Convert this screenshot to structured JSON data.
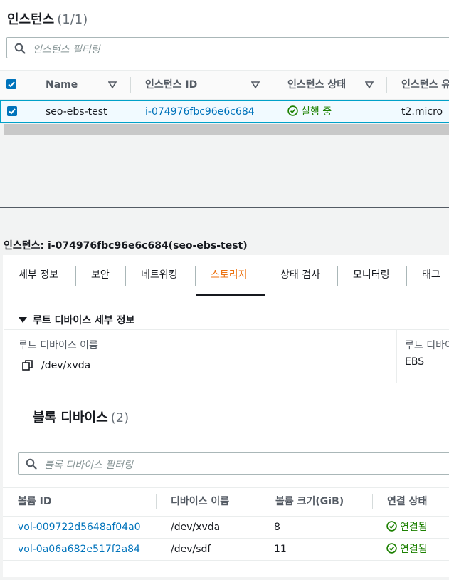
{
  "instances": {
    "title": "인스턴스",
    "count": "(1/1)",
    "filter_placeholder": "인스턴스 필터링",
    "columns": [
      "Name",
      "인스턴스 ID",
      "인스턴스 상태",
      "인스턴스 유"
    ],
    "rows": [
      {
        "name": "seo-ebs-test",
        "instance_id": "i-074976fbc96e6c684",
        "state": "실행 중",
        "type": "t2.micro"
      }
    ]
  },
  "detail": {
    "title_prefix": "인스턴스:",
    "title_value": "i-074976fbc96e6c684(seo-ebs-test)",
    "tabs": [
      "세부 정보",
      "보안",
      "네트워킹",
      "스토리지",
      "상태 검사",
      "모니터링",
      "태그"
    ],
    "active_tab": "스토리지",
    "root_section": {
      "heading": "루트 디바이스 세부 정보",
      "device_name_label": "루트 디바이스 이름",
      "device_name_value": "/dev/xvda",
      "device_type_label": "루트 디바이",
      "device_type_value": "EBS"
    },
    "block_devices": {
      "title": "블록 디바이스",
      "count": "(2)",
      "filter_placeholder": "블록 디바이스 필터링",
      "columns": [
        "볼륨 ID",
        "디바이스 이름",
        "볼륨 크기(GiB)",
        "연결 상태"
      ],
      "rows": [
        {
          "volume_id": "vol-009722d5648af04a0",
          "device": "/dev/xvda",
          "size": "8",
          "status": "연결됨"
        },
        {
          "volume_id": "vol-0a06a682e517f2a84",
          "device": "/dev/sdf",
          "size": "11",
          "status": "연결됨"
        }
      ]
    }
  },
  "colors": {
    "accent": "#0073bb",
    "success": "#1d8102",
    "active_tab": "#ec7211"
  }
}
